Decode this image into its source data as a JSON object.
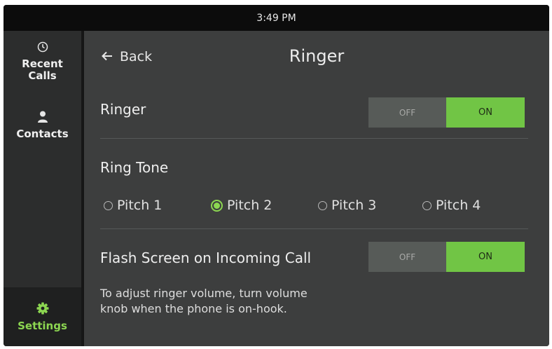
{
  "status_bar": {
    "time": "3:49 PM"
  },
  "sidebar": {
    "items": [
      {
        "label_line1": "Recent",
        "label_line2": "Calls",
        "icon": "clock-icon"
      },
      {
        "label": "Contacts",
        "icon": "person-icon"
      },
      {
        "label": "Settings",
        "icon": "gear-icon",
        "active": true
      }
    ]
  },
  "header": {
    "back_label": "Back",
    "title": "Ringer"
  },
  "ringer": {
    "label": "Ringer",
    "off_label": "OFF",
    "on_label": "ON",
    "value": "ON"
  },
  "ring_tone": {
    "label": "Ring Tone",
    "options": [
      "Pitch 1",
      "Pitch 2",
      "Pitch 3",
      "Pitch 4"
    ],
    "selected": "Pitch 2"
  },
  "flash_screen": {
    "label": "Flash Screen on Incoming Call",
    "off_label": "OFF",
    "on_label": "ON",
    "value": "ON"
  },
  "hint": {
    "line1": "To adjust ringer volume, turn volume",
    "line2": "knob when the phone is on-hook."
  },
  "colors": {
    "accent": "#71c545",
    "accent_text": "#8cd651",
    "background": "#3d3e3e",
    "sidebar": "#2c2d2d"
  }
}
